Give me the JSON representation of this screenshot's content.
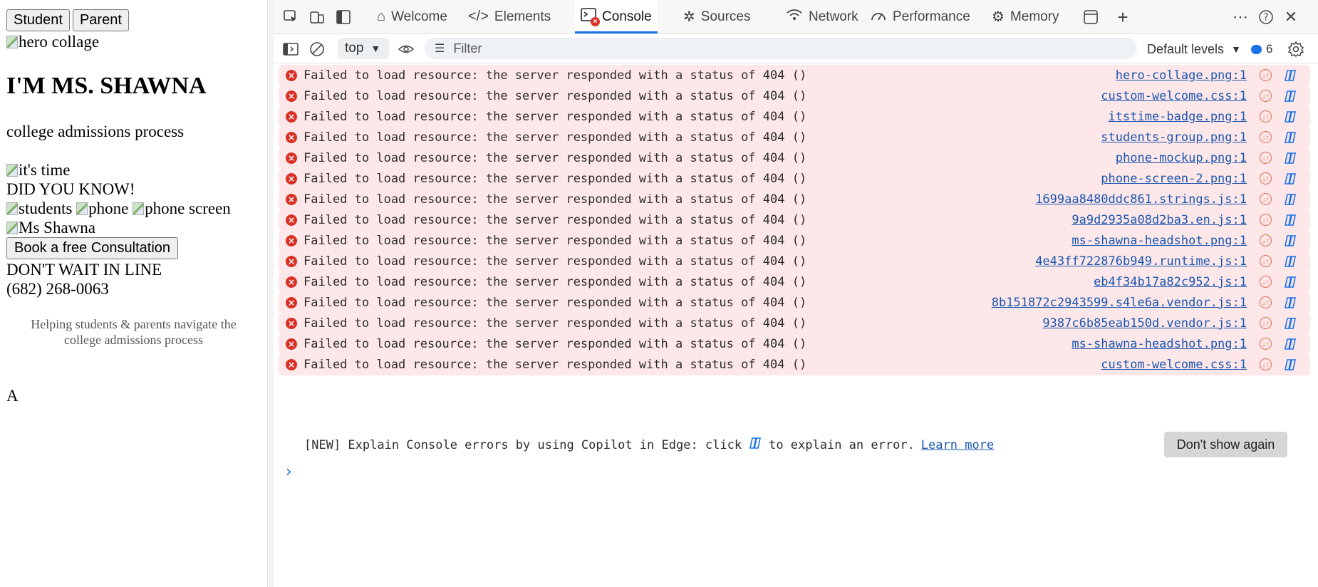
{
  "page": {
    "buttons": {
      "student": "Student",
      "parent": "Parent"
    },
    "images": {
      "hero": "hero collage",
      "its_time": "it's time",
      "students": "students",
      "phone": "phone",
      "phone_screen": "phone screen",
      "ms_shawna": "Ms Shawna"
    },
    "heading": "I'M MS. SHAWNA",
    "tagline": "college admissions process",
    "did_you_know": "DID YOU KNOW!",
    "consult_button": "Book a free Consultation",
    "dont_wait": "DON'T WAIT IN LINE",
    "phone_number": "(682) 268-0063",
    "helping_line1": "Helping students & parents navigate the",
    "helping_line2": "college admissions process",
    "letter": "A"
  },
  "devtools": {
    "tabs": [
      {
        "label": "Welcome",
        "icon": "home-icon"
      },
      {
        "label": "Elements",
        "icon": "code-icon"
      },
      {
        "label": "Console",
        "icon": "console-icon",
        "active": true
      },
      {
        "label": "Sources",
        "icon": "bug-icon"
      },
      {
        "label": "Network",
        "icon": "wifi-icon"
      },
      {
        "label": "Performance",
        "icon": "gauge-icon"
      },
      {
        "label": "Memory",
        "icon": "chip-icon"
      }
    ],
    "toolbar": {
      "context": "top",
      "filter_placeholder": "Filter",
      "levels": "Default levels",
      "issue_count": "6"
    },
    "messages": [
      {
        "text": "Failed to load resource: the server responded with a status of 404 ()",
        "source": "hero-collage.png:1"
      },
      {
        "text": "Failed to load resource: the server responded with a status of 404 ()",
        "source": "custom-welcome.css:1"
      },
      {
        "text": "Failed to load resource: the server responded with a status of 404 ()",
        "source": "itstime-badge.png:1"
      },
      {
        "text": "Failed to load resource: the server responded with a status of 404 ()",
        "source": "students-group.png:1"
      },
      {
        "text": "Failed to load resource: the server responded with a status of 404 ()",
        "source": "phone-mockup.png:1"
      },
      {
        "text": "Failed to load resource: the server responded with a status of 404 ()",
        "source": "phone-screen-2.png:1"
      },
      {
        "text": "Failed to load resource: the server responded with a status of 404 ()",
        "source": "1699aa8480ddc861.strings.js:1"
      },
      {
        "text": "Failed to load resource: the server responded with a status of 404 ()",
        "source": "9a9d2935a08d2ba3.en.js:1"
      },
      {
        "text": "Failed to load resource: the server responded with a status of 404 ()",
        "source": "ms-shawna-headshot.png:1"
      },
      {
        "text": "Failed to load resource: the server responded with a status of 404 ()",
        "source": "4e43ff722876b949.runtime.js:1"
      },
      {
        "text": "Failed to load resource: the server responded with a status of 404 ()",
        "source": "eb4f34b17a82c952.js:1"
      },
      {
        "text": "Failed to load resource: the server responded with a status of 404 ()",
        "source": "8b151872c2943599.s4le6a.vendor.js:1"
      },
      {
        "text": "Failed to load resource: the server responded with a status of 404 ()",
        "source": "9387c6b85eab150d.vendor.js:1"
      },
      {
        "text": "Failed to load resource: the server responded with a status of 404 ()",
        "source": "ms-shawna-headshot.png:1"
      },
      {
        "text": "Failed to load resource: the server responded with a status of 404 ()",
        "source": "custom-welcome.css:1"
      }
    ],
    "banner": {
      "text_before": "[NEW] Explain Console errors by using Copilot in Edge: click",
      "text_after": "to explain an error.",
      "learn_more": "Learn more",
      "dismiss": "Don't show again"
    },
    "prompt_symbol": "›",
    "colors": {
      "accent": "#1a73e8",
      "error_bg": "#fde7e9",
      "error_icon": "#d93025",
      "link": "#1a56b0"
    }
  }
}
